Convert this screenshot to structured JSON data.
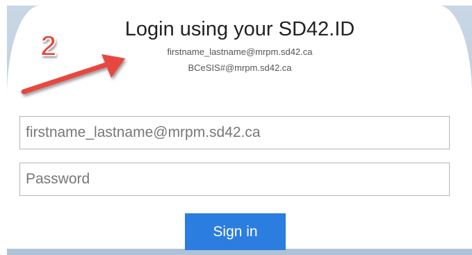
{
  "login": {
    "title": "Login using your SD42.ID",
    "hint_line_1": "firstname_lastname@mrpm.sd42.ca",
    "hint_line_2": "BCeSIS#@mrpm.sd42.ca",
    "username_placeholder": "firstname_lastname@mrpm.sd42.ca",
    "password_placeholder": "Password",
    "signin_label": "Sign in"
  },
  "annotation": {
    "step_number": "2",
    "color": "#e8473f"
  },
  "colors": {
    "button": "#2b7de0",
    "backdrop": "#c9d7e5"
  }
}
